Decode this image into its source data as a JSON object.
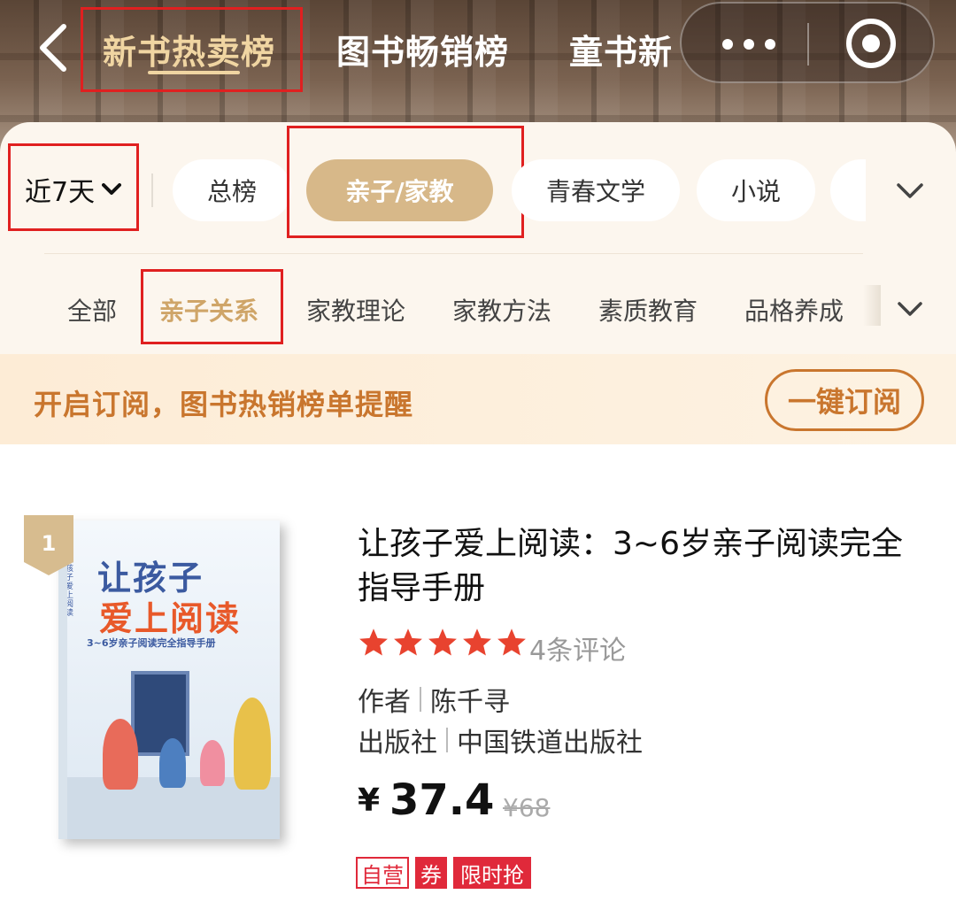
{
  "top_nav": {
    "tabs": [
      {
        "label": "新书热卖榜",
        "active": true
      },
      {
        "label": "图书畅销榜",
        "active": false
      },
      {
        "label": "童书新",
        "active": false
      }
    ],
    "icons": {
      "back": "chevron-left-icon",
      "more": "more-dots-icon",
      "close": "record-circle-icon"
    }
  },
  "filters": {
    "range_label": "近7天",
    "categories": [
      "总榜",
      "亲子/家教",
      "青春文学",
      "小说"
    ],
    "active_category": "亲子/家教",
    "subcategories": [
      "全部",
      "亲子关系",
      "家教理论",
      "家教方法",
      "素质教育",
      "品格养成"
    ],
    "active_subcategory": "亲子关系"
  },
  "banner": {
    "text": "开启订阅，图书热销榜单提醒",
    "button_label": "一键订阅"
  },
  "book": {
    "rank": "1",
    "title": "让孩子爱上阅读：3~6岁亲子阅读完全指导手册",
    "rating": 5,
    "reviews": "4条评论",
    "author_label": "作者",
    "author": "陈千寻",
    "publisher_label": "出版社",
    "publisher": "中国铁道出版社",
    "price_symbol": "¥",
    "price": "37.4",
    "original_price": "¥68",
    "tags": [
      "自营",
      "券",
      "限时抢"
    ],
    "cover": {
      "title_line1": "让孩子",
      "title_line2": "爱上阅读",
      "tagline": "3~6岁亲子阅读完全指导手册"
    }
  },
  "colors": {
    "accent_gold": "#d7b889",
    "banner_orange": "#c9762e",
    "highlight_red": "#e02020",
    "star_red": "#e8432f"
  }
}
